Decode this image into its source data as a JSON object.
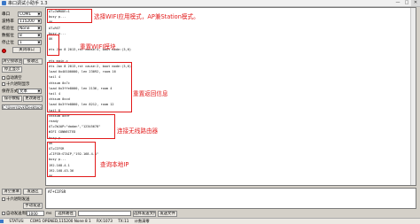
{
  "window": {
    "title": "串口调试小助手 1.3",
    "min": "—",
    "max": "□",
    "close": "✕"
  },
  "settings": [
    {
      "label": "串口",
      "value": "COM1"
    },
    {
      "label": "波特率",
      "value": "115200"
    },
    {
      "label": "校验位",
      "value": "None"
    },
    {
      "label": "数据位",
      "value": "8"
    },
    {
      "label": "停止位",
      "value": "1"
    }
  ],
  "buttons": {
    "open_close": "关闭串口",
    "clear_recv": "清空接收区",
    "recv_area": "接收区",
    "stop_display": "停止显示",
    "auto_clear": "自动清空",
    "select_path": "选择路径",
    "save_data": "保存数据",
    "change_path": "更改路径",
    "clear_send": "清空重填",
    "send": "发送区",
    "manual_send": "手动发送",
    "select_file": "选择发送文件",
    "send_file": "发送文件"
  },
  "checkboxes": {
    "hex_display": "十六进制显示",
    "hex_send": "十六进制发送",
    "auto_send": "自动发送周期"
  },
  "save_mode": {
    "label": "保存方式",
    "value": "文本"
  },
  "save_path": "C:\\Users\\zyk\\Desktop\\",
  "terminal_lines": [
    "AT+CWMODE=1",
    "busy p...",
    "OK",
    "AT+RST",
    "busy p...",
    "OK",
    "",
    "ets Jan  8 2013,rst cause:4, boot mode:(3,6)",
    "",
    "ets_main.c",
    "ets Jan  8 2013,rst cause:2, boot mode:(3,6)",
    "load 0x40100000, len 23092, room 16",
    "tail 4",
    "chksum 0x7c",
    "load 0x3ffe8000, len 2136, room 4",
    "tail 4",
    "chksum 0xcd",
    "load 0x3ffe8860, len 8212, room 12",
    "tail 8",
    "chksum 0x9f",
    "ready",
    "AT+CWJAP=\"dadan\",\"12345678\"",
    "WIFI CONNECTED",
    "busy p...",
    "OK",
    "AT+CIFSR",
    "+CIFSR:STAIP,\"192.168.4.1\"",
    "busy p...",
    "192.168.4.1",
    "192.168.43.36",
    "OK"
  ],
  "annotations": [
    "选择WIFI应用模式，AP兼Station模式。",
    "重置WIFI模块",
    "重置返回信息",
    "连接无线路由器",
    "查询本地IP"
  ],
  "send_text": "AT+CIFSR",
  "auto_send_period": "1000",
  "period_unit": "ms",
  "status": {
    "state": "STATUS:",
    "port_info": "COM1 OPENED,115200 None 8 1",
    "rx": "RX:1073",
    "tx": "TX:11",
    "counter": "计数清零"
  }
}
